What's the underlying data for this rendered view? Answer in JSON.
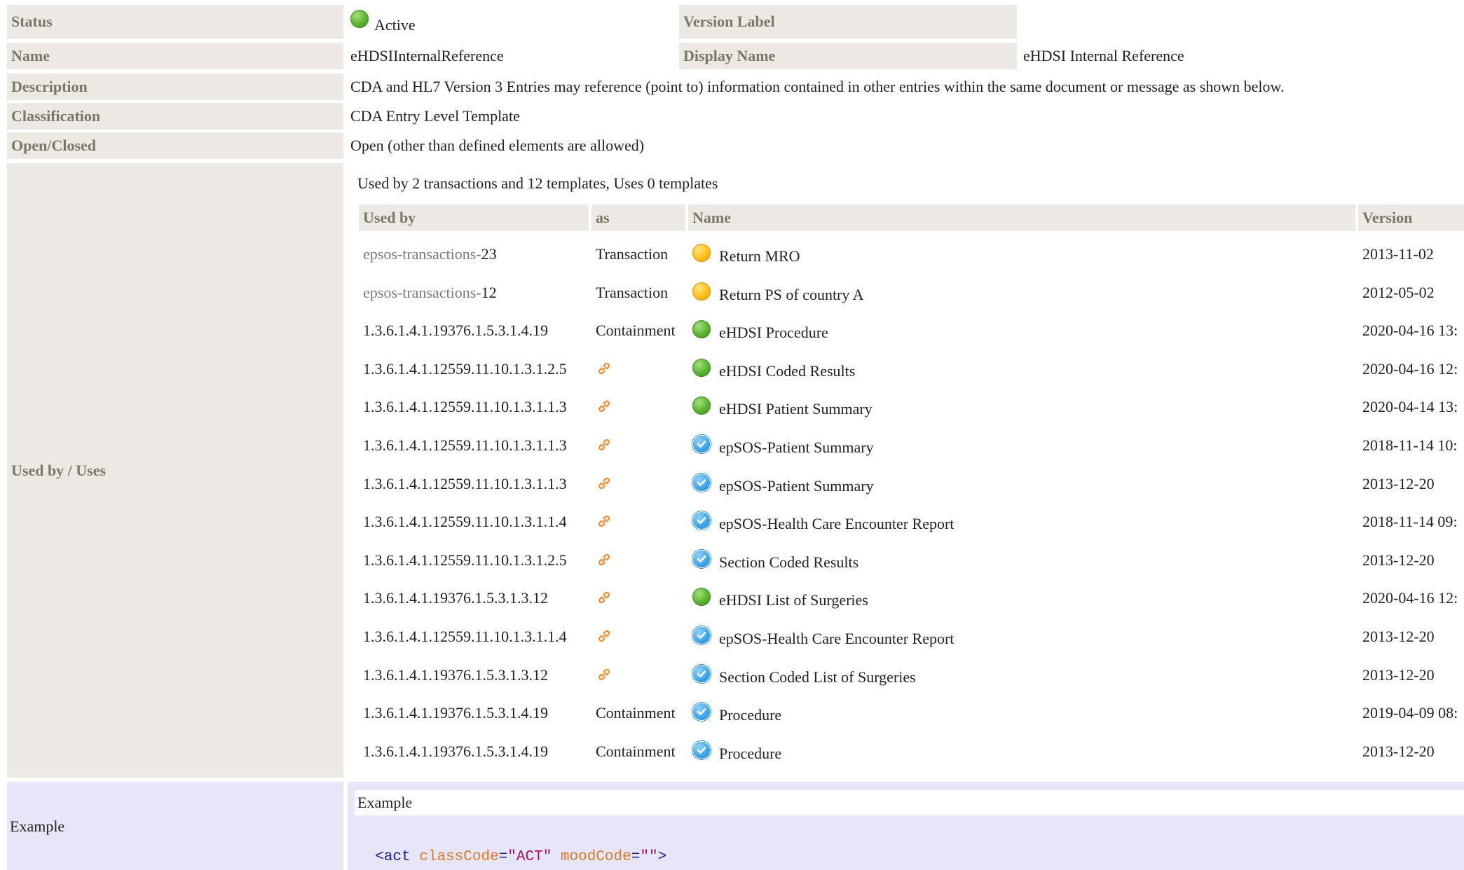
{
  "labels": {
    "status": "Status",
    "version_label": "Version Label",
    "name": "Name",
    "display_name": "Display Name",
    "description": "Description",
    "classification": "Classification",
    "open_closed": "Open/Closed",
    "used_by_uses": "Used by / Uses",
    "example": "Example"
  },
  "values": {
    "status": "Active",
    "version_label": "",
    "name": "eHDSIInternalReference",
    "display_name": "eHDSI Internal Reference",
    "description": "CDA and HL7 Version 3 Entries may reference (point to) information contained in other entries within the same document or message as shown below.",
    "classification": "CDA Entry Level Template",
    "open_closed": "Open (other than defined elements are allowed)"
  },
  "usage": {
    "summary": "Used by 2 transactions and 12 templates, Uses 0 templates",
    "headers": {
      "used_by": "Used by",
      "as": "as",
      "name": "Name",
      "version": "Version"
    },
    "rows": [
      {
        "prefix": "epsos-transactions-",
        "id": "23",
        "as": "Transaction",
        "icon": "yellow",
        "name": "Return MRO",
        "version": "2013-11-02"
      },
      {
        "prefix": "epsos-transactions-",
        "id": "12",
        "as": "Transaction",
        "icon": "yellow",
        "name": "Return PS of country A",
        "version": "2012-05-02"
      },
      {
        "prefix": "",
        "id": "1.3.6.1.4.1.19376.1.5.3.1.4.19",
        "as": "Containment",
        "icon": "green",
        "name": "eHDSI Procedure",
        "version": "2020-04-16 13:"
      },
      {
        "prefix": "",
        "id": "1.3.6.1.4.1.12559.11.10.1.3.1.2.5",
        "as": "link",
        "icon": "green",
        "name": "eHDSI Coded Results",
        "version": "2020-04-16 12:"
      },
      {
        "prefix": "",
        "id": "1.3.6.1.4.1.12559.11.10.1.3.1.1.3",
        "as": "link",
        "icon": "green",
        "name": "eHDSI Patient Summary",
        "version": "2020-04-14 13:"
      },
      {
        "prefix": "",
        "id": "1.3.6.1.4.1.12559.11.10.1.3.1.1.3",
        "as": "link",
        "icon": "blue",
        "name": "epSOS-Patient Summary",
        "version": "2018-11-14 10:"
      },
      {
        "prefix": "",
        "id": "1.3.6.1.4.1.12559.11.10.1.3.1.1.3",
        "as": "link",
        "icon": "blue",
        "name": "epSOS-Patient Summary",
        "version": "2013-12-20"
      },
      {
        "prefix": "",
        "id": "1.3.6.1.4.1.12559.11.10.1.3.1.1.4",
        "as": "link",
        "icon": "blue",
        "name": "epSOS-Health Care Encounter Report",
        "version": "2018-11-14 09:"
      },
      {
        "prefix": "",
        "id": "1.3.6.1.4.1.12559.11.10.1.3.1.2.5",
        "as": "link",
        "icon": "blue",
        "name": "Section Coded Results",
        "version": "2013-12-20"
      },
      {
        "prefix": "",
        "id": "1.3.6.1.4.1.19376.1.5.3.1.3.12",
        "as": "link",
        "icon": "green",
        "name": "eHDSI List of Surgeries",
        "version": "2020-04-16 12:"
      },
      {
        "prefix": "",
        "id": "1.3.6.1.4.1.12559.11.10.1.3.1.1.4",
        "as": "link",
        "icon": "blue",
        "name": "epSOS-Health Care Encounter Report",
        "version": "2013-12-20"
      },
      {
        "prefix": "",
        "id": "1.3.6.1.4.1.19376.1.5.3.1.3.12",
        "as": "link",
        "icon": "blue",
        "name": "Section Coded List of Surgeries",
        "version": "2013-12-20"
      },
      {
        "prefix": "",
        "id": "1.3.6.1.4.1.19376.1.5.3.1.4.19",
        "as": "Containment",
        "icon": "blue",
        "name": "Procedure",
        "version": "2019-04-09 08:"
      },
      {
        "prefix": "",
        "id": "1.3.6.1.4.1.19376.1.5.3.1.4.19",
        "as": "Containment",
        "icon": "blue",
        "name": "Procedure",
        "version": "2013-12-20"
      }
    ]
  },
  "example": {
    "title": "Example",
    "code": {
      "open": "<act",
      "attr1": "classCode",
      "eq1": "=",
      "val1": "\"ACT\"",
      "attr2": "moodCode",
      "eq2": "=",
      "val2": "\"\"",
      "close": ">"
    }
  },
  "colors": {
    "label_bg": "#ece9e4",
    "label_text": "#7d7668",
    "example_bg": "#e6e6f8",
    "link_icon": "#ee8a2c",
    "code_tag": "#1b1b8a",
    "code_attr": "#d97a2c",
    "code_value": "#a0125a"
  }
}
